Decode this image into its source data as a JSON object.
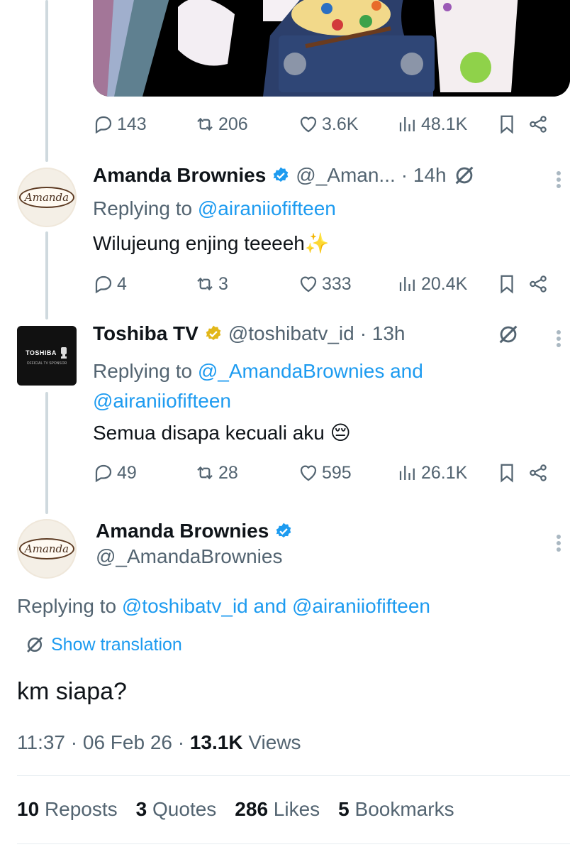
{
  "top_tweet": {
    "stats": {
      "replies": "143",
      "reposts": "206",
      "likes": "3.6K",
      "views": "48.1K"
    }
  },
  "replies": [
    {
      "name": "Amanda Brownies",
      "handle": "@_Aman...",
      "time": "· 14h",
      "avatar_text": "Amanda",
      "replying_label": "Replying to",
      "replying_to": "@airaniiofifteen",
      "text": "Wilujeung enjing teeeeh✨",
      "stats": {
        "replies": "4",
        "reposts": "3",
        "likes": "333",
        "views": "20.4K"
      }
    },
    {
      "name": "Toshiba TV",
      "handle": "@toshibatv_id",
      "time": "· 13h",
      "avatar_text": "TOSHIBA",
      "avatar_subtext": "OFFICIAL TV SPONSOR",
      "replying_label": "Replying to",
      "replying_to_line1": "@_AmandaBrownies and",
      "replying_to_line2": "@airaniiofifteen",
      "text": "Semua disapa kecuali aku 😔",
      "stats": {
        "replies": "49",
        "reposts": "28",
        "likes": "595",
        "views": "26.1K"
      }
    }
  ],
  "main_tweet": {
    "name": "Amanda Brownies",
    "handle": "@_AmandaBrownies",
    "avatar_text": "Amanda",
    "replying_label": "Replying to",
    "replying_to": "@toshibatv_id and @airaniiofifteen",
    "show_translation": "Show translation",
    "text": "km siapa?",
    "timestamp": "11:37 · 06 Feb 26 ·",
    "views_count": "13.1K",
    "views_label": "Views",
    "engagement": {
      "reposts_count": "10",
      "reposts_label": "Reposts",
      "quotes_count": "3",
      "quotes_label": "Quotes",
      "likes_count": "286",
      "likes_label": "Likes",
      "bookmarks_count": "5",
      "bookmarks_label": "Bookmarks"
    }
  },
  "colors": {
    "accent": "#1d9bf0",
    "muted": "#536471",
    "verified_blue": "#1d9bf0",
    "verified_gold": "#e2b719"
  }
}
